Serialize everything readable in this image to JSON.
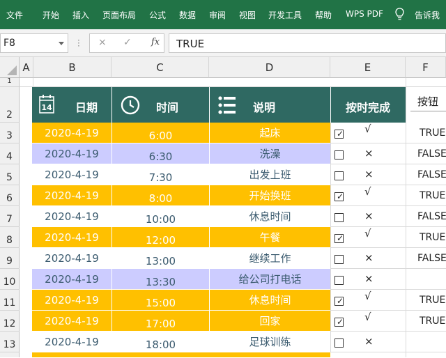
{
  "ribbon": {
    "menu": [
      "文件",
      "开始",
      "插入",
      "页面布局",
      "公式",
      "数据",
      "审阅",
      "视图",
      "开发工具",
      "帮助",
      "WPS PDF",
      "告诉我"
    ]
  },
  "formula_bar": {
    "name_box": "F8",
    "cancel_icon": "×",
    "enter_icon": "✓",
    "fx_label": "fx",
    "content": "TRUE"
  },
  "columns": [
    "A",
    "B",
    "C",
    "D",
    "E",
    "F"
  ],
  "rows": [
    "1",
    "2",
    "3",
    "4",
    "5",
    "6",
    "7",
    "8",
    "9",
    "10",
    "11",
    "12",
    "13"
  ],
  "table": {
    "headers": {
      "date": "日期",
      "time": "时间",
      "desc": "说明",
      "done": "按时完成",
      "button": "按钮"
    },
    "calendar_day": "14",
    "data": [
      {
        "date": "2020-4-19",
        "time": "6:00",
        "desc": "起床",
        "checked": true,
        "mark": "√",
        "f": "TRUE"
      },
      {
        "date": "2020-4-19",
        "time": "6:30",
        "desc": "洗澡",
        "checked": false,
        "mark": "×",
        "f": "FALSE"
      },
      {
        "date": "2020-4-19",
        "time": "7:30",
        "desc": "出发上班",
        "checked": false,
        "mark": "×",
        "f": "FALSE"
      },
      {
        "date": "2020-4-19",
        "time": "8:00",
        "desc": "开始换班",
        "checked": true,
        "mark": "√",
        "f": "TRUE"
      },
      {
        "date": "2020-4-19",
        "time": "10:00",
        "desc": "休息时间",
        "checked": false,
        "mark": "×",
        "f": "FALSE"
      },
      {
        "date": "2020-4-19",
        "time": "12:00",
        "desc": "午餐",
        "checked": true,
        "mark": "√",
        "f": "TRUE"
      },
      {
        "date": "2020-4-19",
        "time": "13:00",
        "desc": "继续工作",
        "checked": false,
        "mark": "×",
        "f": "FALSE"
      },
      {
        "date": "2020-4-19",
        "time": "13:30",
        "desc": "给公司打电话",
        "checked": false,
        "mark": "×",
        "f": ""
      },
      {
        "date": "2020-4-19",
        "time": "15:00",
        "desc": "休息时间",
        "checked": true,
        "mark": "√",
        "f": "TRUE"
      },
      {
        "date": "2020-4-19",
        "time": "17:00",
        "desc": "回家",
        "checked": true,
        "mark": "√",
        "f": "TRUE"
      },
      {
        "date": "2020-4-19",
        "time": "18:00",
        "desc": "足球训练",
        "checked": false,
        "mark": "×",
        "f": ""
      }
    ]
  },
  "colors": {
    "ribbon": "#217346",
    "table_header": "#2f6962",
    "row_yellow": "#ffc000",
    "row_lavender": "#ccccff",
    "row_white": "#ffffff"
  }
}
